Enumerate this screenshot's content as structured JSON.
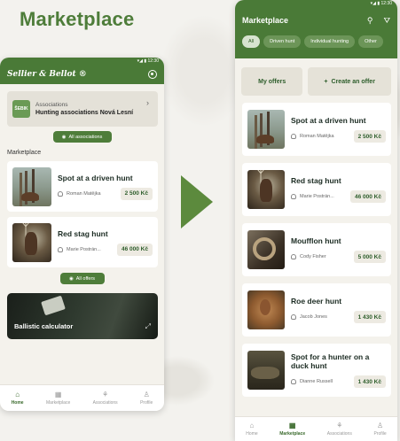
{
  "page_heading": "Marketplace",
  "left_screen": {
    "status": "▾◢ ▮ 12:30",
    "brand": "Sellier & Bellot ®",
    "association": {
      "logo_text": "ŠEBIK",
      "label": "Associations",
      "name": "Hunting associations Nová Lesní",
      "button": "All associations"
    },
    "section_label": "Marketplace",
    "offers": [
      {
        "title": "Spot at a driven hunt",
        "person": "Roman Matějka",
        "price": "2 500 Kč",
        "thumb": "t-hunt"
      },
      {
        "title": "Red stag hunt",
        "person": "Marie Postrán...",
        "price": "46 000 Kč",
        "thumb": "t-stag"
      }
    ],
    "all_offers_button": "All offers",
    "ballistic": {
      "title": "Ballistic calculator"
    },
    "nav": [
      {
        "label": "Home",
        "icon": "⌂",
        "active": true
      },
      {
        "label": "Marketplace",
        "icon": "▦",
        "active": false
      },
      {
        "label": "Associations",
        "icon": "⚘",
        "active": false
      },
      {
        "label": "Profile",
        "icon": "♙",
        "active": false
      }
    ]
  },
  "right_screen": {
    "status": "▾◢ ▮ 12:30",
    "title": "Marketplace",
    "chips": [
      {
        "label": "All",
        "active": true
      },
      {
        "label": "Driven hunt",
        "active": false
      },
      {
        "label": "Individual hunting",
        "active": false
      },
      {
        "label": "Other",
        "active": false
      }
    ],
    "my_offers": "My offers",
    "create_offer": "Create an offer",
    "offers": [
      {
        "title": "Spot at a driven hunt",
        "person": "Roman Matějka",
        "price": "2 500 Kč",
        "thumb": "t-hunt"
      },
      {
        "title": "Red stag hunt",
        "person": "Marie Postrán...",
        "price": "46 000 Kč",
        "thumb": "t-stag"
      },
      {
        "title": "Moufflon hunt",
        "person": "Cody Fisher",
        "price": "5 000 Kč",
        "thumb": "t-mouflon"
      },
      {
        "title": "Roe deer hunt",
        "person": "Jacob Jones",
        "price": "1 430 Kč",
        "thumb": "t-roe"
      },
      {
        "title": "Spot for a hunter on a duck hunt",
        "person": "Dianne Russell",
        "price": "1 430 Kč",
        "thumb": "t-duck"
      }
    ],
    "nav": [
      {
        "label": "Home",
        "icon": "⌂",
        "active": false
      },
      {
        "label": "Marketplace",
        "icon": "▦",
        "active": true
      },
      {
        "label": "Associations",
        "icon": "⚘",
        "active": false
      },
      {
        "label": "Profile",
        "icon": "♙",
        "active": false
      }
    ]
  }
}
